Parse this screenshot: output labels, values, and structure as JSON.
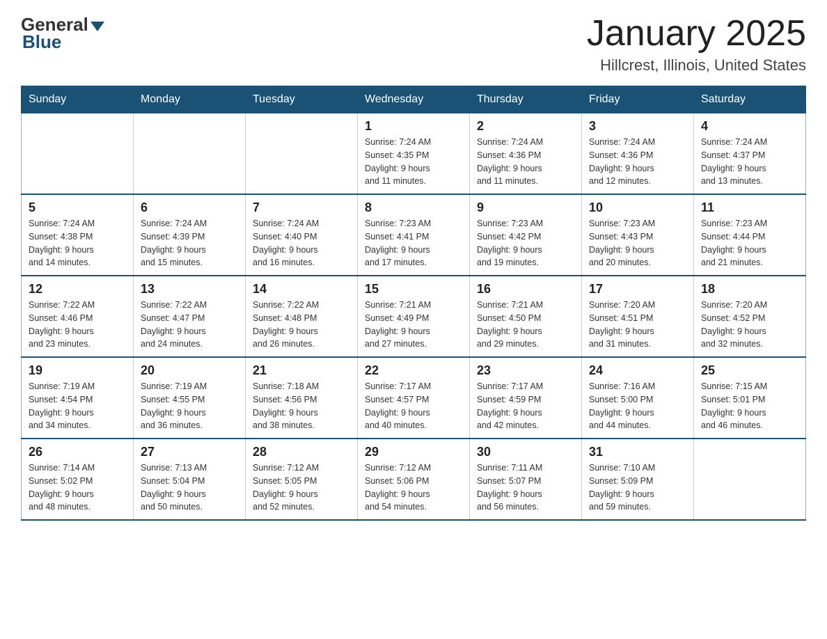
{
  "logo": {
    "general": "General",
    "blue": "Blue"
  },
  "title": "January 2025",
  "location": "Hillcrest, Illinois, United States",
  "days_header": [
    "Sunday",
    "Monday",
    "Tuesday",
    "Wednesday",
    "Thursday",
    "Friday",
    "Saturday"
  ],
  "weeks": [
    [
      {
        "day": "",
        "info": ""
      },
      {
        "day": "",
        "info": ""
      },
      {
        "day": "",
        "info": ""
      },
      {
        "day": "1",
        "info": "Sunrise: 7:24 AM\nSunset: 4:35 PM\nDaylight: 9 hours\nand 11 minutes."
      },
      {
        "day": "2",
        "info": "Sunrise: 7:24 AM\nSunset: 4:36 PM\nDaylight: 9 hours\nand 11 minutes."
      },
      {
        "day": "3",
        "info": "Sunrise: 7:24 AM\nSunset: 4:36 PM\nDaylight: 9 hours\nand 12 minutes."
      },
      {
        "day": "4",
        "info": "Sunrise: 7:24 AM\nSunset: 4:37 PM\nDaylight: 9 hours\nand 13 minutes."
      }
    ],
    [
      {
        "day": "5",
        "info": "Sunrise: 7:24 AM\nSunset: 4:38 PM\nDaylight: 9 hours\nand 14 minutes."
      },
      {
        "day": "6",
        "info": "Sunrise: 7:24 AM\nSunset: 4:39 PM\nDaylight: 9 hours\nand 15 minutes."
      },
      {
        "day": "7",
        "info": "Sunrise: 7:24 AM\nSunset: 4:40 PM\nDaylight: 9 hours\nand 16 minutes."
      },
      {
        "day": "8",
        "info": "Sunrise: 7:23 AM\nSunset: 4:41 PM\nDaylight: 9 hours\nand 17 minutes."
      },
      {
        "day": "9",
        "info": "Sunrise: 7:23 AM\nSunset: 4:42 PM\nDaylight: 9 hours\nand 19 minutes."
      },
      {
        "day": "10",
        "info": "Sunrise: 7:23 AM\nSunset: 4:43 PM\nDaylight: 9 hours\nand 20 minutes."
      },
      {
        "day": "11",
        "info": "Sunrise: 7:23 AM\nSunset: 4:44 PM\nDaylight: 9 hours\nand 21 minutes."
      }
    ],
    [
      {
        "day": "12",
        "info": "Sunrise: 7:22 AM\nSunset: 4:46 PM\nDaylight: 9 hours\nand 23 minutes."
      },
      {
        "day": "13",
        "info": "Sunrise: 7:22 AM\nSunset: 4:47 PM\nDaylight: 9 hours\nand 24 minutes."
      },
      {
        "day": "14",
        "info": "Sunrise: 7:22 AM\nSunset: 4:48 PM\nDaylight: 9 hours\nand 26 minutes."
      },
      {
        "day": "15",
        "info": "Sunrise: 7:21 AM\nSunset: 4:49 PM\nDaylight: 9 hours\nand 27 minutes."
      },
      {
        "day": "16",
        "info": "Sunrise: 7:21 AM\nSunset: 4:50 PM\nDaylight: 9 hours\nand 29 minutes."
      },
      {
        "day": "17",
        "info": "Sunrise: 7:20 AM\nSunset: 4:51 PM\nDaylight: 9 hours\nand 31 minutes."
      },
      {
        "day": "18",
        "info": "Sunrise: 7:20 AM\nSunset: 4:52 PM\nDaylight: 9 hours\nand 32 minutes."
      }
    ],
    [
      {
        "day": "19",
        "info": "Sunrise: 7:19 AM\nSunset: 4:54 PM\nDaylight: 9 hours\nand 34 minutes."
      },
      {
        "day": "20",
        "info": "Sunrise: 7:19 AM\nSunset: 4:55 PM\nDaylight: 9 hours\nand 36 minutes."
      },
      {
        "day": "21",
        "info": "Sunrise: 7:18 AM\nSunset: 4:56 PM\nDaylight: 9 hours\nand 38 minutes."
      },
      {
        "day": "22",
        "info": "Sunrise: 7:17 AM\nSunset: 4:57 PM\nDaylight: 9 hours\nand 40 minutes."
      },
      {
        "day": "23",
        "info": "Sunrise: 7:17 AM\nSunset: 4:59 PM\nDaylight: 9 hours\nand 42 minutes."
      },
      {
        "day": "24",
        "info": "Sunrise: 7:16 AM\nSunset: 5:00 PM\nDaylight: 9 hours\nand 44 minutes."
      },
      {
        "day": "25",
        "info": "Sunrise: 7:15 AM\nSunset: 5:01 PM\nDaylight: 9 hours\nand 46 minutes."
      }
    ],
    [
      {
        "day": "26",
        "info": "Sunrise: 7:14 AM\nSunset: 5:02 PM\nDaylight: 9 hours\nand 48 minutes."
      },
      {
        "day": "27",
        "info": "Sunrise: 7:13 AM\nSunset: 5:04 PM\nDaylight: 9 hours\nand 50 minutes."
      },
      {
        "day": "28",
        "info": "Sunrise: 7:12 AM\nSunset: 5:05 PM\nDaylight: 9 hours\nand 52 minutes."
      },
      {
        "day": "29",
        "info": "Sunrise: 7:12 AM\nSunset: 5:06 PM\nDaylight: 9 hours\nand 54 minutes."
      },
      {
        "day": "30",
        "info": "Sunrise: 7:11 AM\nSunset: 5:07 PM\nDaylight: 9 hours\nand 56 minutes."
      },
      {
        "day": "31",
        "info": "Sunrise: 7:10 AM\nSunset: 5:09 PM\nDaylight: 9 hours\nand 59 minutes."
      },
      {
        "day": "",
        "info": ""
      }
    ]
  ]
}
